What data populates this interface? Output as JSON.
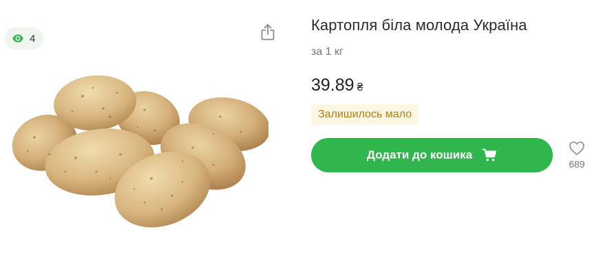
{
  "gallery": {
    "views_count": "4",
    "icons": {
      "views": "eye-icon",
      "share": "share-icon"
    },
    "image_subject": "potatoes"
  },
  "product": {
    "title": "Картопля біла молода Україна",
    "unit": "за 1 кг",
    "price": "39.89",
    "currency": "₴",
    "stock_status": "Залишилось мало",
    "add_to_cart_label": "Додати до кошика",
    "favorites_count": "689",
    "icons": {
      "cart": "cart-icon",
      "favorite": "heart-icon"
    }
  },
  "colors": {
    "accent_green": "#2fb64d",
    "views_badge_bg": "#eef6ef",
    "stock_badge_bg": "#fdf6e2",
    "stock_badge_text": "#b47f1a"
  }
}
